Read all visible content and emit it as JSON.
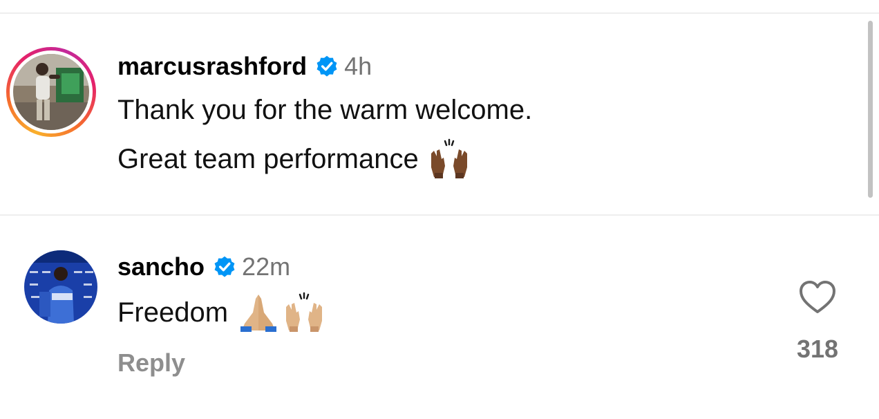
{
  "comments": [
    {
      "username": "marcusrashford",
      "verified": true,
      "time": "4h",
      "lines": [
        "Thank you for the warm welcome.",
        "Great team performance"
      ],
      "emoji": [
        "raising-hands-dark"
      ],
      "avatar_story_ring": true
    },
    {
      "username": "sancho",
      "verified": true,
      "time": "22m",
      "text": "Freedom",
      "emoji": [
        "folded-hands-light",
        "raising-hands-light"
      ],
      "reply_label": "Reply",
      "like_count": "318"
    }
  ],
  "colors": {
    "verified_blue": "#0095f6",
    "secondary_text": "#737373",
    "reply_text": "#8e8e8e",
    "divider": "#eeeeee"
  },
  "icons": {
    "verified": "verified-badge-icon",
    "like": "heart-outline-icon"
  }
}
